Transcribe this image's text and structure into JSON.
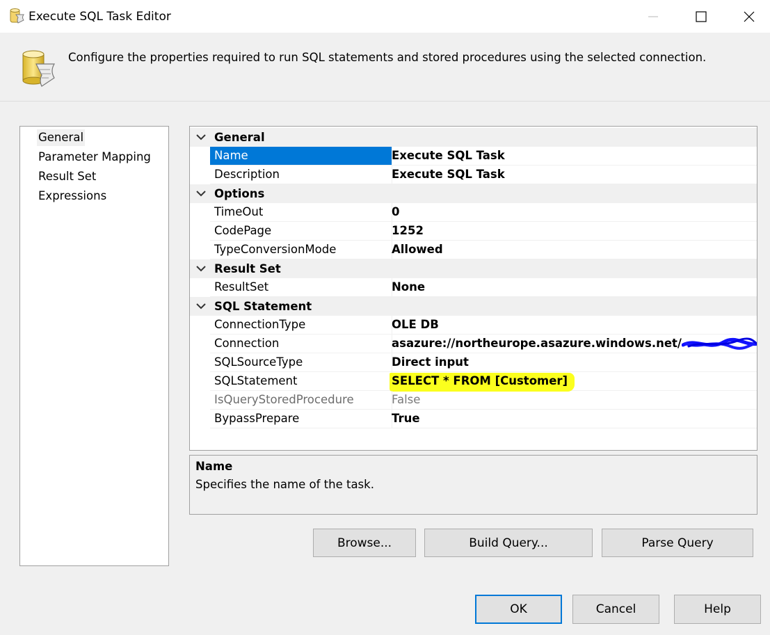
{
  "window": {
    "title": "Execute SQL Task Editor",
    "controls": [
      "minimize-icon",
      "maximize-icon",
      "close-icon"
    ]
  },
  "header": {
    "icon": "sql-task-icon",
    "description": "Configure the properties required to run SQL statements and stored procedures using the selected connection."
  },
  "nav": {
    "items": [
      {
        "label": "General",
        "selected": true
      },
      {
        "label": "Parameter Mapping",
        "selected": false
      },
      {
        "label": "Result Set",
        "selected": false
      },
      {
        "label": "Expressions",
        "selected": false
      }
    ]
  },
  "grid": {
    "categories": [
      {
        "label": "General",
        "properties": [
          {
            "name": "Name",
            "value": "Execute SQL Task",
            "selected": true
          },
          {
            "name": "Description",
            "value": "Execute SQL Task"
          }
        ]
      },
      {
        "label": "Options",
        "properties": [
          {
            "name": "TimeOut",
            "value": "0"
          },
          {
            "name": "CodePage",
            "value": "1252"
          },
          {
            "name": "TypeConversionMode",
            "value": "Allowed"
          }
        ]
      },
      {
        "label": "Result Set",
        "properties": [
          {
            "name": "ResultSet",
            "value": "None"
          }
        ]
      },
      {
        "label": "SQL Statement",
        "properties": [
          {
            "name": "ConnectionType",
            "value": "OLE DB"
          },
          {
            "name": "Connection",
            "value": "asazure://northeurope.asazure.windows.net/"
          },
          {
            "name": "SQLSourceType",
            "value": "Direct input"
          },
          {
            "name": "SQLStatement",
            "value": "SELECT * FROM [Customer]"
          },
          {
            "name": "IsQueryStoredProcedure",
            "value": "False"
          },
          {
            "name": "BypassPrepare",
            "value": "True"
          }
        ]
      }
    ]
  },
  "description_pane": {
    "title": "Name",
    "text": "Specifies the name of the task."
  },
  "buttons": {
    "browse": "Browse...",
    "build_query": "Build Query...",
    "parse_query": "Parse Query",
    "ok": "OK",
    "cancel": "Cancel",
    "help": "Help"
  },
  "colors": {
    "selection": "#0078d7",
    "highlighter": "#fbff1e",
    "redaction_scribble": "#1010ff"
  }
}
